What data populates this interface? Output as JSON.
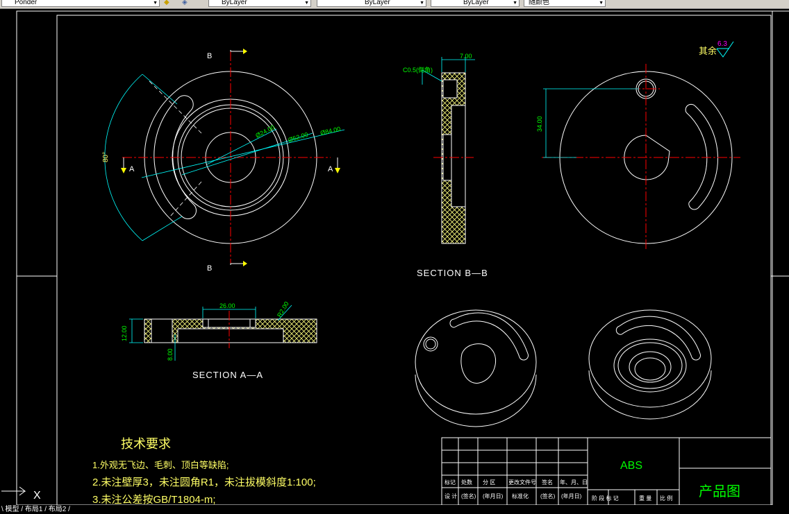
{
  "toolbar": {
    "plot_style": "Ponder",
    "linetype": "ByLayer",
    "lineweight": "ByLayer",
    "color": "ByLayer",
    "color_control": "随颜色"
  },
  "drawing": {
    "section_bb": "SECTION B—B",
    "section_aa": "SECTION A—A",
    "cut_label_b": "B",
    "cut_label_a": "A",
    "surface_finish_label": "其余",
    "surface_finish_value": "6.3",
    "dims": {
      "d24": "Ø24.00",
      "d52": "Ø52.00",
      "d84": "Ø84.00",
      "angle80": "80°",
      "w7": "7.00",
      "c05": "C0.5(倒角)",
      "h34": "34.00",
      "w26": "26.00",
      "h12": "12.00",
      "h8": "8.00",
      "r2": "R2.00"
    }
  },
  "tech_requirements": {
    "title": "技术要求",
    "items": [
      "1.外观无飞边、毛刺、顶白等缺陷;",
      "2.未注壁厚3，未注圆角R1，未注拔模斜度1:100;",
      "3.未注公差按GB/T1804-m;"
    ]
  },
  "title_block": {
    "material": "ABS",
    "name": "产品图",
    "row1": [
      "标记",
      "处数",
      "分  区",
      "更改文件号",
      "签名",
      "年、月、日"
    ],
    "row2": [
      "设  计",
      "(签名)",
      "(年月日)",
      "标准化",
      "(签名)",
      "(年月日)"
    ],
    "row3": [
      "阶 段 标 记",
      "重 量",
      "比 例"
    ]
  },
  "command_line": "\\ 模型 / 布局1 / 布局2 /",
  "ucs": {
    "x_label": "X"
  },
  "colors": {
    "background": "#000000",
    "geometry": "#ffffff",
    "centerline": "#ff0000",
    "dimension": "#00ffff",
    "dim_text": "#00ff00",
    "hatch": "#ffff80",
    "text": "#ffff66",
    "finish": "#ff00ff",
    "border": "#ffffff"
  }
}
